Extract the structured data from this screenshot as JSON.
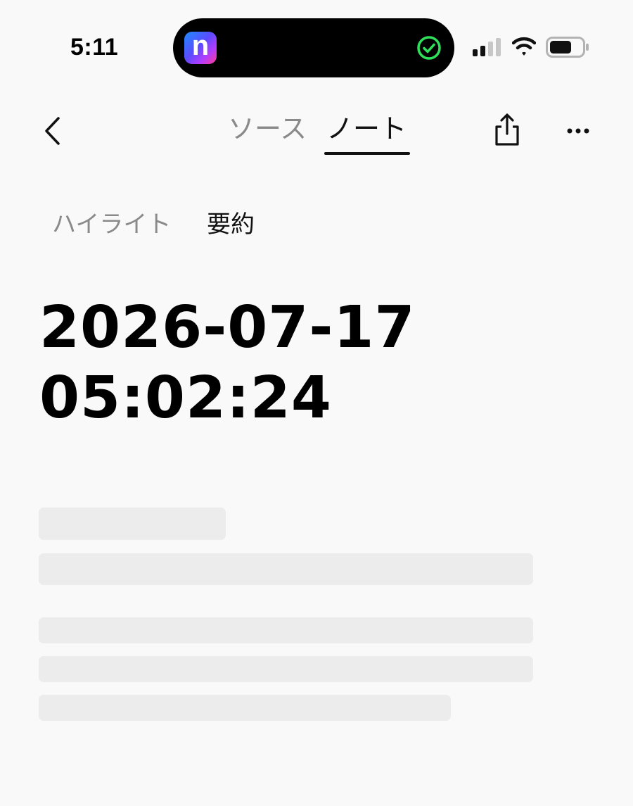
{
  "status_bar": {
    "time": "5:11",
    "island_app_letter": "n",
    "icons": [
      "app-icon",
      "check-circle-icon",
      "cellular-signal-icon",
      "wifi-icon",
      "battery-icon"
    ]
  },
  "nav": {
    "tabs": [
      {
        "label": "ソース",
        "active": false
      },
      {
        "label": "ノート",
        "active": true
      }
    ],
    "icons": [
      "chevron-left-icon",
      "share-icon",
      "more-icon"
    ]
  },
  "segments": [
    {
      "label": "ハイライト",
      "active": false
    },
    {
      "label": "要約",
      "active": true
    }
  ],
  "note": {
    "title_date": "2026-07-17",
    "title_time": "05:02:24"
  },
  "colors": {
    "background": "#f9f9f9",
    "skeleton": "#ececec",
    "inactive_text": "#8a8a8a",
    "success_green": "#2ee05a"
  }
}
